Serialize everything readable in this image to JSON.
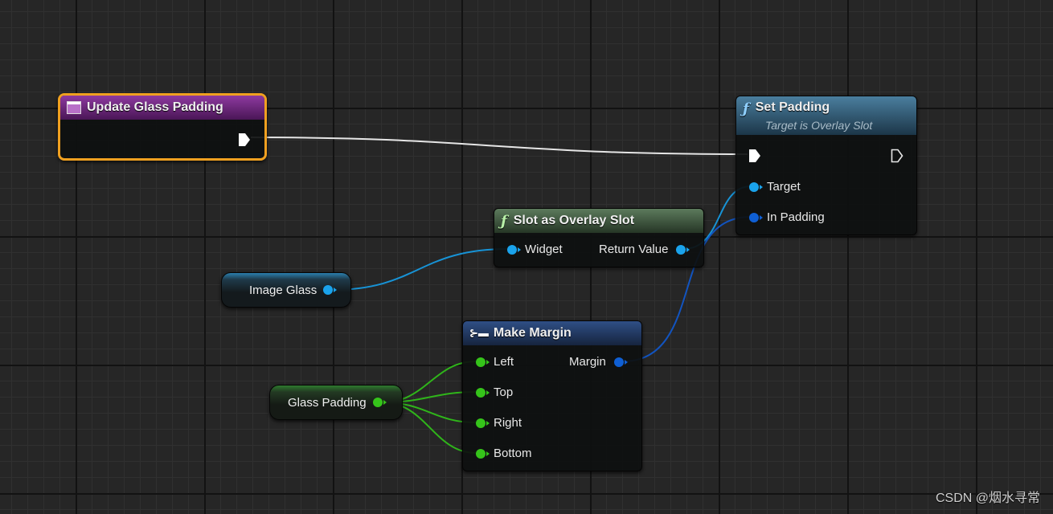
{
  "graph": {
    "event_node": {
      "title": "Update Glass Padding",
      "accent": "#7d2a8e",
      "selected_color": "#f5a623"
    },
    "set_padding": {
      "title": "Set Padding",
      "subtitle": "Target is Overlay Slot",
      "target_label": "Target",
      "in_padding_label": "In Padding"
    },
    "slot_as_overlay": {
      "title": "Slot as Overlay Slot",
      "widget_label": "Widget",
      "return_label": "Return Value"
    },
    "image_glass": {
      "label": "Image Glass"
    },
    "make_margin": {
      "title": "Make Margin",
      "left": "Left",
      "top": "Top",
      "right": "Right",
      "bottom": "Bottom",
      "margin": "Margin"
    },
    "glass_padding": {
      "label": "Glass Padding"
    }
  },
  "colors": {
    "object_pin": "#1aa3ec",
    "struct_pin": "#0f5fd4",
    "float_pin": "#35c41a",
    "exec_wire": "#e0e0e0"
  },
  "watermark": "CSDN @烟水寻常"
}
